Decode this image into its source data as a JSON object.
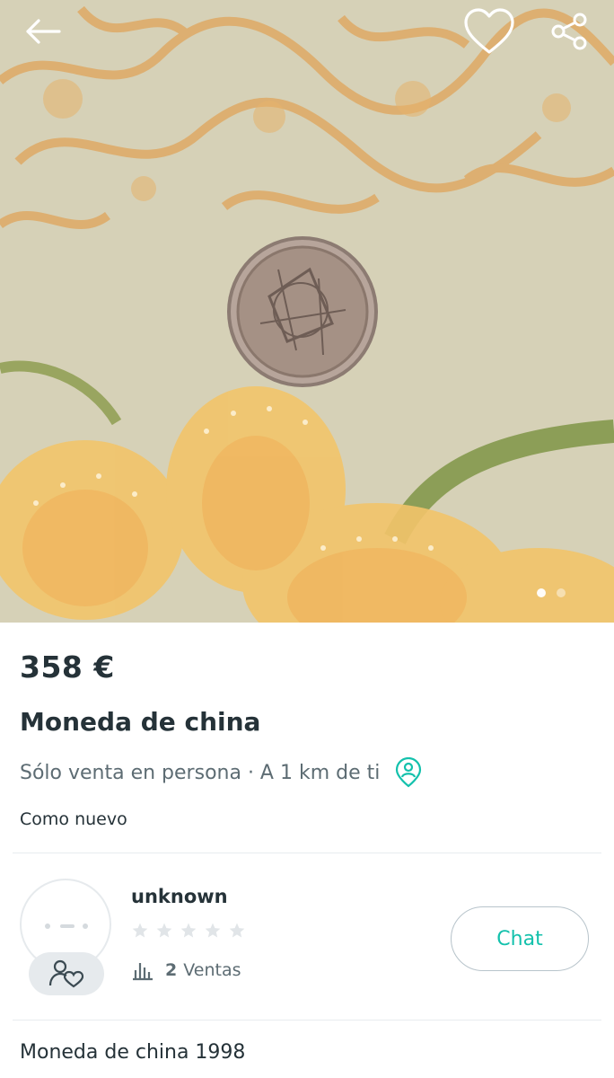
{
  "product": {
    "price": "358 €",
    "title": "Moneda de china",
    "delivery": "Sólo venta en persona · A 1 km de ti",
    "condition": "Como nuevo",
    "description": "Moneda de china 1998"
  },
  "gallery": {
    "image_count": 2,
    "current_index": 1
  },
  "topbar": {
    "icons": [
      "arrow-left-icon",
      "heart-icon",
      "share-icon"
    ]
  },
  "seller": {
    "username": "unknown",
    "rating_stars": 0,
    "rating_max": 5,
    "sales_count": "2",
    "sales_label": "Ventas"
  },
  "actions": {
    "chat_label": "Chat"
  },
  "colors": {
    "accent": "#13c1ac",
    "text_dark": "#253238",
    "text_muted": "#5d6c73",
    "star_empty": "#e1e5e8"
  }
}
